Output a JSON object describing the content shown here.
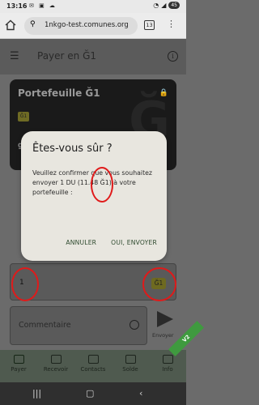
{
  "status_bar": {
    "time": "13:16",
    "battery": "45"
  },
  "browser": {
    "url": "1nkgo-test.comunes.org",
    "tab_count": "13"
  },
  "app": {
    "title": "Payer en Ğ1"
  },
  "card": {
    "title": "Portefeuille Ğ1",
    "chip_label": "Ğ1",
    "key": "g1NP…Bt2W",
    "watermark": "Ğ"
  },
  "form": {
    "amount_value": "1",
    "amount_unit": "Ğ1",
    "comment_placeholder": "Commentaire",
    "send_label": "Envoyer"
  },
  "nav": {
    "items": [
      {
        "label": "Payer"
      },
      {
        "label": "Recevoir"
      },
      {
        "label": "Contacts"
      },
      {
        "label": "Solde"
      },
      {
        "label": "Info"
      }
    ],
    "ribbon": "V2"
  },
  "dialog": {
    "title": "Êtes-vous sûr ?",
    "body": "Veuillez confirmer que vous souhaitez envoyer 1 DU (11.48 Ğ1) à votre portefeuille :",
    "cancel_label": "ANNULER",
    "confirm_label": "OUI, ENVOYER"
  },
  "colors": {
    "annotation": "#e01a1a",
    "accent": "#3f9a3f"
  }
}
